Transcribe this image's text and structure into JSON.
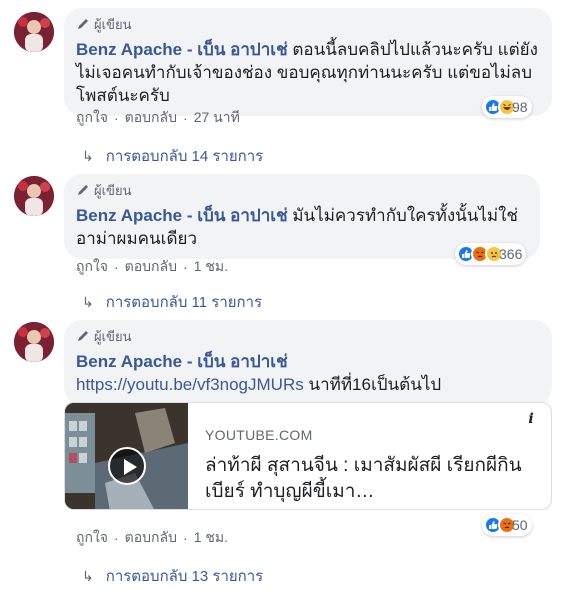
{
  "comments": [
    {
      "author_badge": "ผู้เขียน",
      "author": "Benz Apache - เบ็น อาปาเช่",
      "text": " ตอนนี้ลบคลิปไปแล้วนะครับ แต่ยังไม่เจอคนทำกับเจ้าของช่อง ขอบคุณทุกท่านนะครับ แต่ขอไม่ลบโพสต์นะครับ",
      "like_label": "ถูกใจ",
      "reply_label": "ตอบกลับ",
      "time": "27 นาที",
      "reactions": [
        "like",
        "haha"
      ],
      "reaction_count": "98",
      "replies_label": "การตอบกลับ 14 รายการ"
    },
    {
      "author_badge": "ผู้เขียน",
      "author": "Benz Apache - เบ็น อาปาเช่",
      "text": " มันไม่ควรทำกับใครทั้งนั้นไม่ใช่อาม่าผมคนเดียว",
      "like_label": "ถูกใจ",
      "reply_label": "ตอบกลับ",
      "time": "1 ชม.",
      "reactions": [
        "like",
        "angry",
        "sad"
      ],
      "reaction_count": "366",
      "replies_label": "การตอบกลับ 11 รายการ"
    },
    {
      "author_badge": "ผู้เขียน",
      "author": "Benz Apache - เบ็น อาปาเช่",
      "link": "https://youtu.be/vf3nogJMURs",
      "text": " นาทีที่16เป็นต้นไป",
      "like_label": "ถูกใจ",
      "reply_label": "ตอบกลับ",
      "time": "1 ชม.",
      "reactions": [
        "like",
        "angry"
      ],
      "reaction_count": "50",
      "replies_label": "การตอบกลับ 13 รายการ",
      "card": {
        "domain": "YOUTUBE.COM",
        "title": "ล่าท้าผี สุสานจีน : เมาสัมผัสผี เรียกผีกินเบียร์ ทำบุญผีขี้เมา…",
        "info_glyph": "i"
      }
    }
  ],
  "separator": "·",
  "reply_arrow": "↳",
  "colors": {
    "link": "#385898",
    "bubble": "#f2f3f5",
    "meta": "#606770"
  }
}
